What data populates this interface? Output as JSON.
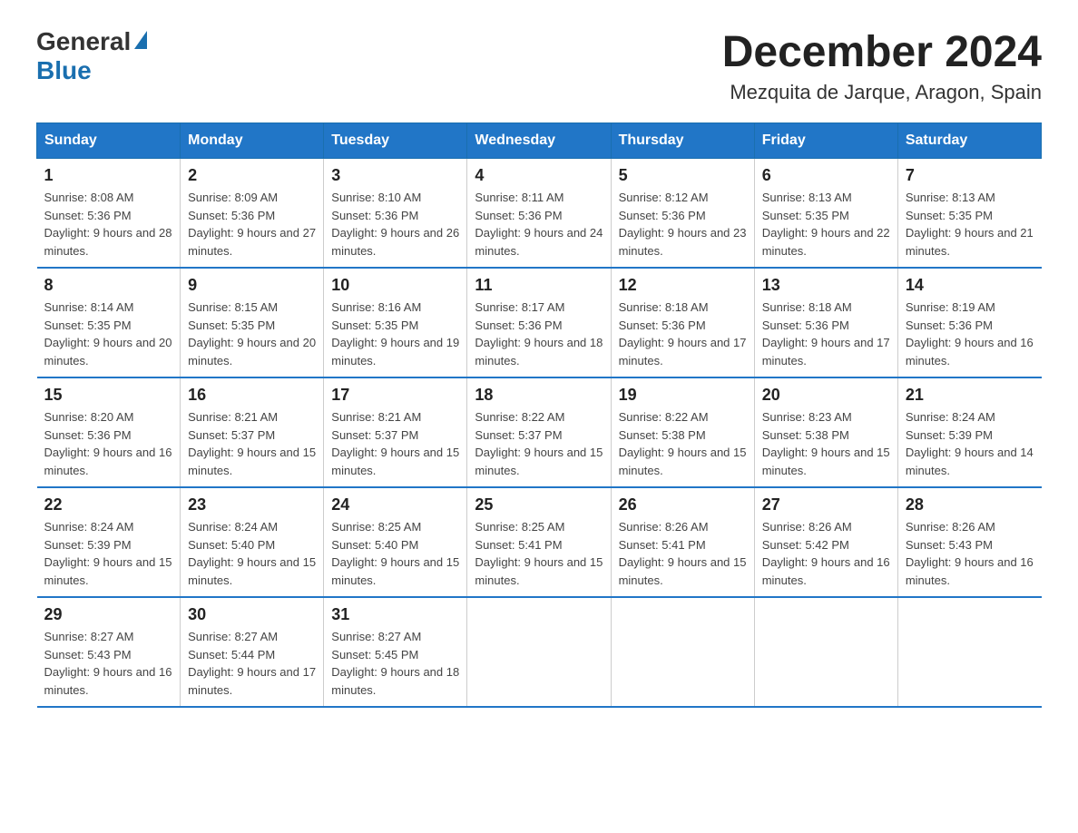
{
  "logo": {
    "general": "General",
    "blue": "Blue"
  },
  "title": "December 2024",
  "subtitle": "Mezquita de Jarque, Aragon, Spain",
  "days_of_week": [
    "Sunday",
    "Monday",
    "Tuesday",
    "Wednesday",
    "Thursday",
    "Friday",
    "Saturday"
  ],
  "weeks": [
    [
      {
        "day": "1",
        "sunrise": "8:08 AM",
        "sunset": "5:36 PM",
        "daylight": "9 hours and 28 minutes."
      },
      {
        "day": "2",
        "sunrise": "8:09 AM",
        "sunset": "5:36 PM",
        "daylight": "9 hours and 27 minutes."
      },
      {
        "day": "3",
        "sunrise": "8:10 AM",
        "sunset": "5:36 PM",
        "daylight": "9 hours and 26 minutes."
      },
      {
        "day": "4",
        "sunrise": "8:11 AM",
        "sunset": "5:36 PM",
        "daylight": "9 hours and 24 minutes."
      },
      {
        "day": "5",
        "sunrise": "8:12 AM",
        "sunset": "5:36 PM",
        "daylight": "9 hours and 23 minutes."
      },
      {
        "day": "6",
        "sunrise": "8:13 AM",
        "sunset": "5:35 PM",
        "daylight": "9 hours and 22 minutes."
      },
      {
        "day": "7",
        "sunrise": "8:13 AM",
        "sunset": "5:35 PM",
        "daylight": "9 hours and 21 minutes."
      }
    ],
    [
      {
        "day": "8",
        "sunrise": "8:14 AM",
        "sunset": "5:35 PM",
        "daylight": "9 hours and 20 minutes."
      },
      {
        "day": "9",
        "sunrise": "8:15 AM",
        "sunset": "5:35 PM",
        "daylight": "9 hours and 20 minutes."
      },
      {
        "day": "10",
        "sunrise": "8:16 AM",
        "sunset": "5:35 PM",
        "daylight": "9 hours and 19 minutes."
      },
      {
        "day": "11",
        "sunrise": "8:17 AM",
        "sunset": "5:36 PM",
        "daylight": "9 hours and 18 minutes."
      },
      {
        "day": "12",
        "sunrise": "8:18 AM",
        "sunset": "5:36 PM",
        "daylight": "9 hours and 17 minutes."
      },
      {
        "day": "13",
        "sunrise": "8:18 AM",
        "sunset": "5:36 PM",
        "daylight": "9 hours and 17 minutes."
      },
      {
        "day": "14",
        "sunrise": "8:19 AM",
        "sunset": "5:36 PM",
        "daylight": "9 hours and 16 minutes."
      }
    ],
    [
      {
        "day": "15",
        "sunrise": "8:20 AM",
        "sunset": "5:36 PM",
        "daylight": "9 hours and 16 minutes."
      },
      {
        "day": "16",
        "sunrise": "8:21 AM",
        "sunset": "5:37 PM",
        "daylight": "9 hours and 15 minutes."
      },
      {
        "day": "17",
        "sunrise": "8:21 AM",
        "sunset": "5:37 PM",
        "daylight": "9 hours and 15 minutes."
      },
      {
        "day": "18",
        "sunrise": "8:22 AM",
        "sunset": "5:37 PM",
        "daylight": "9 hours and 15 minutes."
      },
      {
        "day": "19",
        "sunrise": "8:22 AM",
        "sunset": "5:38 PM",
        "daylight": "9 hours and 15 minutes."
      },
      {
        "day": "20",
        "sunrise": "8:23 AM",
        "sunset": "5:38 PM",
        "daylight": "9 hours and 15 minutes."
      },
      {
        "day": "21",
        "sunrise": "8:24 AM",
        "sunset": "5:39 PM",
        "daylight": "9 hours and 14 minutes."
      }
    ],
    [
      {
        "day": "22",
        "sunrise": "8:24 AM",
        "sunset": "5:39 PM",
        "daylight": "9 hours and 15 minutes."
      },
      {
        "day": "23",
        "sunrise": "8:24 AM",
        "sunset": "5:40 PM",
        "daylight": "9 hours and 15 minutes."
      },
      {
        "day": "24",
        "sunrise": "8:25 AM",
        "sunset": "5:40 PM",
        "daylight": "9 hours and 15 minutes."
      },
      {
        "day": "25",
        "sunrise": "8:25 AM",
        "sunset": "5:41 PM",
        "daylight": "9 hours and 15 minutes."
      },
      {
        "day": "26",
        "sunrise": "8:26 AM",
        "sunset": "5:41 PM",
        "daylight": "9 hours and 15 minutes."
      },
      {
        "day": "27",
        "sunrise": "8:26 AM",
        "sunset": "5:42 PM",
        "daylight": "9 hours and 16 minutes."
      },
      {
        "day": "28",
        "sunrise": "8:26 AM",
        "sunset": "5:43 PM",
        "daylight": "9 hours and 16 minutes."
      }
    ],
    [
      {
        "day": "29",
        "sunrise": "8:27 AM",
        "sunset": "5:43 PM",
        "daylight": "9 hours and 16 minutes."
      },
      {
        "day": "30",
        "sunrise": "8:27 AM",
        "sunset": "5:44 PM",
        "daylight": "9 hours and 17 minutes."
      },
      {
        "day": "31",
        "sunrise": "8:27 AM",
        "sunset": "5:45 PM",
        "daylight": "9 hours and 18 minutes."
      },
      null,
      null,
      null,
      null
    ]
  ]
}
